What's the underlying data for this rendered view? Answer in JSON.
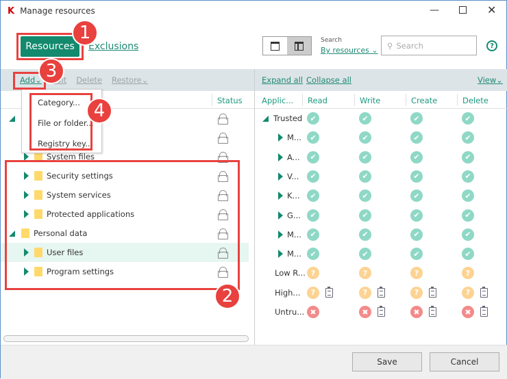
{
  "window": {
    "title": "Manage resources",
    "controls": [
      "minimize",
      "maximize",
      "close"
    ]
  },
  "header": {
    "tab_active": "Resources",
    "tab_link": "Exclusions",
    "search_label": "Search",
    "search_by": "By resources",
    "search_placeholder": "Search",
    "help": "?"
  },
  "left_toolbar": {
    "add": "Add",
    "edit": "Edit",
    "delete": "Delete",
    "restore": "Restore"
  },
  "add_menu": [
    "Category...",
    "File or folder...",
    "Registry key..."
  ],
  "left_columns": {
    "status": "Status"
  },
  "tree": [
    {
      "label": "",
      "level": 0,
      "expanded": true
    },
    {
      "label": "",
      "level": 1
    },
    {
      "label": "System files",
      "level": 1
    },
    {
      "label": "Security settings",
      "level": 1
    },
    {
      "label": "System services",
      "level": 1
    },
    {
      "label": "Protected applications",
      "level": 1
    },
    {
      "label": "Personal data",
      "level": 0,
      "expanded": true
    },
    {
      "label": "User files",
      "level": 1,
      "selected": true
    },
    {
      "label": "Program settings",
      "level": 1
    }
  ],
  "right_toolbar": {
    "expand": "Expand all",
    "collapse": "Collapse all",
    "view": "View"
  },
  "right_columns": [
    "Applic...",
    "Read",
    "Write",
    "Create",
    "Delete"
  ],
  "rights": [
    {
      "name": "Trusted",
      "type": "group",
      "cells": [
        "allow",
        "allow",
        "allow",
        "allow"
      ],
      "log": [
        false,
        false,
        false,
        false
      ]
    },
    {
      "name": "M...",
      "type": "child",
      "cells": [
        "allow",
        "allow",
        "allow",
        "allow"
      ],
      "log": [
        false,
        false,
        false,
        false
      ]
    },
    {
      "name": "A...",
      "type": "child",
      "cells": [
        "allow",
        "allow",
        "allow",
        "allow"
      ],
      "log": [
        false,
        false,
        false,
        false
      ]
    },
    {
      "name": "V...",
      "type": "child",
      "cells": [
        "allow",
        "allow",
        "allow",
        "allow"
      ],
      "log": [
        false,
        false,
        false,
        false
      ]
    },
    {
      "name": "K...",
      "type": "child",
      "cells": [
        "allow",
        "allow",
        "allow",
        "allow"
      ],
      "log": [
        false,
        false,
        false,
        false
      ]
    },
    {
      "name": "G...",
      "type": "child",
      "cells": [
        "allow",
        "allow",
        "allow",
        "allow"
      ],
      "log": [
        false,
        false,
        false,
        false
      ]
    },
    {
      "name": "M...",
      "type": "child",
      "cells": [
        "allow",
        "allow",
        "allow",
        "allow"
      ],
      "log": [
        false,
        false,
        false,
        false
      ]
    },
    {
      "name": "M...",
      "type": "child",
      "cells": [
        "allow",
        "allow",
        "allow",
        "allow"
      ],
      "log": [
        false,
        false,
        false,
        false
      ]
    },
    {
      "name": "Low R...",
      "type": "plain",
      "cells": [
        "ask",
        "ask",
        "ask",
        "ask"
      ],
      "log": [
        false,
        false,
        false,
        false
      ]
    },
    {
      "name": "High...",
      "type": "plain",
      "cells": [
        "ask",
        "ask",
        "ask",
        "ask"
      ],
      "log": [
        true,
        true,
        true,
        true
      ]
    },
    {
      "name": "Untru...",
      "type": "plain",
      "cells": [
        "deny",
        "deny",
        "deny",
        "deny"
      ],
      "log": [
        false,
        true,
        true,
        true
      ]
    }
  ],
  "footer": {
    "save": "Save",
    "cancel": "Cancel"
  },
  "annotations": [
    "1",
    "2",
    "3",
    "4"
  ],
  "colors": {
    "accent": "#1d9a80",
    "annotation": "#e8413e",
    "allow": "#8fd8c6",
    "ask": "#fdd393",
    "deny": "#f48a8a"
  }
}
